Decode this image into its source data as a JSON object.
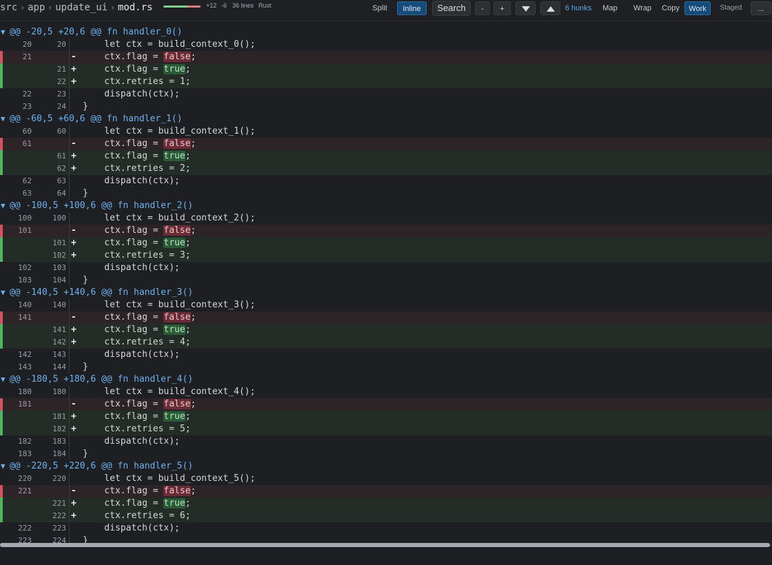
{
  "breadcrumb": {
    "parts": [
      "src",
      "app",
      "update_ui"
    ],
    "current": "mod.rs",
    "separator": "›"
  },
  "file_stats": {
    "additions": "+12",
    "deletions": "-6",
    "lines": "36 lines",
    "language": "Rust",
    "add_fraction": 0.67
  },
  "toolbar": {
    "split": "Split",
    "inline": "Inline",
    "search": "Search",
    "collapse": "-",
    "expand": "+",
    "hunks": "6 hunks",
    "map": "Map",
    "wrap": "Wrap",
    "copy": "Copy",
    "work": "Work",
    "staged": "Staged",
    "more": "...",
    "active_view": "Inline",
    "active_tree": "Work"
  },
  "colors": {
    "accent": "#5fa8e8",
    "added": "#4fb45f",
    "removed": "#d3525f"
  },
  "hunks": [
    {
      "header": "@@ -20,5 +20,6 @@ fn handler_0()",
      "lines": [
        {
          "type": "ctx",
          "old": "20",
          "new": "20",
          "sign": "",
          "code": "    let ctx = build_context_0();"
        },
        {
          "type": "del",
          "old": "21",
          "new": "",
          "sign": "-",
          "pre": "    ctx.flag = ",
          "hl": "false",
          "post": ";"
        },
        {
          "type": "add",
          "old": "",
          "new": "21",
          "sign": "+",
          "pre": "    ctx.flag = ",
          "hl": "true",
          "post": ";"
        },
        {
          "type": "add",
          "old": "",
          "new": "22",
          "sign": "+",
          "code": "    ctx.retries = 1;"
        },
        {
          "type": "ctx",
          "old": "22",
          "new": "23",
          "sign": "",
          "code": "    dispatch(ctx);"
        },
        {
          "type": "ctx",
          "old": "23",
          "new": "24",
          "sign": "",
          "code": "}"
        }
      ]
    },
    {
      "header": "@@ -60,5 +60,6 @@ fn handler_1()",
      "lines": [
        {
          "type": "ctx",
          "old": "60",
          "new": "60",
          "sign": "",
          "code": "    let ctx = build_context_1();"
        },
        {
          "type": "del",
          "old": "61",
          "new": "",
          "sign": "-",
          "pre": "    ctx.flag = ",
          "hl": "false",
          "post": ";"
        },
        {
          "type": "add",
          "old": "",
          "new": "61",
          "sign": "+",
          "pre": "    ctx.flag = ",
          "hl": "true",
          "post": ";"
        },
        {
          "type": "add",
          "old": "",
          "new": "62",
          "sign": "+",
          "code": "    ctx.retries = 2;"
        },
        {
          "type": "ctx",
          "old": "62",
          "new": "63",
          "sign": "",
          "code": "    dispatch(ctx);"
        },
        {
          "type": "ctx",
          "old": "63",
          "new": "64",
          "sign": "",
          "code": "}"
        }
      ]
    },
    {
      "header": "@@ -100,5 +100,6 @@ fn handler_2()",
      "lines": [
        {
          "type": "ctx",
          "old": "100",
          "new": "100",
          "sign": "",
          "code": "    let ctx = build_context_2();"
        },
        {
          "type": "del",
          "old": "101",
          "new": "",
          "sign": "-",
          "pre": "    ctx.flag = ",
          "hl": "false",
          "post": ";"
        },
        {
          "type": "add",
          "old": "",
          "new": "101",
          "sign": "+",
          "pre": "    ctx.flag = ",
          "hl": "true",
          "post": ";"
        },
        {
          "type": "add",
          "old": "",
          "new": "102",
          "sign": "+",
          "code": "    ctx.retries = 3;"
        },
        {
          "type": "ctx",
          "old": "102",
          "new": "103",
          "sign": "",
          "code": "    dispatch(ctx);"
        },
        {
          "type": "ctx",
          "old": "103",
          "new": "104",
          "sign": "",
          "code": "}"
        }
      ]
    },
    {
      "header": "@@ -140,5 +140,6 @@ fn handler_3()",
      "lines": [
        {
          "type": "ctx",
          "old": "140",
          "new": "140",
          "sign": "",
          "code": "    let ctx = build_context_3();"
        },
        {
          "type": "del",
          "old": "141",
          "new": "",
          "sign": "-",
          "pre": "    ctx.flag = ",
          "hl": "false",
          "post": ";"
        },
        {
          "type": "add",
          "old": "",
          "new": "141",
          "sign": "+",
          "pre": "    ctx.flag = ",
          "hl": "true",
          "post": ";"
        },
        {
          "type": "add",
          "old": "",
          "new": "142",
          "sign": "+",
          "code": "    ctx.retries = 4;"
        },
        {
          "type": "ctx",
          "old": "142",
          "new": "143",
          "sign": "",
          "code": "    dispatch(ctx);"
        },
        {
          "type": "ctx",
          "old": "143",
          "new": "144",
          "sign": "",
          "code": "}"
        }
      ]
    },
    {
      "header": "@@ -180,5 +180,6 @@ fn handler_4()",
      "lines": [
        {
          "type": "ctx",
          "old": "180",
          "new": "180",
          "sign": "",
          "code": "    let ctx = build_context_4();"
        },
        {
          "type": "del",
          "old": "181",
          "new": "",
          "sign": "-",
          "pre": "    ctx.flag = ",
          "hl": "false",
          "post": ";"
        },
        {
          "type": "add",
          "old": "",
          "new": "181",
          "sign": "+",
          "pre": "    ctx.flag = ",
          "hl": "true",
          "post": ";"
        },
        {
          "type": "add",
          "old": "",
          "new": "182",
          "sign": "+",
          "code": "    ctx.retries = 5;"
        },
        {
          "type": "ctx",
          "old": "182",
          "new": "183",
          "sign": "",
          "code": "    dispatch(ctx);"
        },
        {
          "type": "ctx",
          "old": "183",
          "new": "184",
          "sign": "",
          "code": "}"
        }
      ]
    },
    {
      "header": "@@ -220,5 +220,6 @@ fn handler_5()",
      "lines": [
        {
          "type": "ctx",
          "old": "220",
          "new": "220",
          "sign": "",
          "code": "    let ctx = build_context_5();"
        },
        {
          "type": "del",
          "old": "221",
          "new": "",
          "sign": "-",
          "pre": "    ctx.flag = ",
          "hl": "false",
          "post": ";"
        },
        {
          "type": "add",
          "old": "",
          "new": "221",
          "sign": "+",
          "pre": "    ctx.flag = ",
          "hl": "true",
          "post": ";"
        },
        {
          "type": "add",
          "old": "",
          "new": "222",
          "sign": "+",
          "code": "    ctx.retries = 6;"
        },
        {
          "type": "ctx",
          "old": "222",
          "new": "223",
          "sign": "",
          "code": "    dispatch(ctx);"
        },
        {
          "type": "ctx",
          "old": "223",
          "new": "224",
          "sign": "",
          "code": "}"
        }
      ]
    }
  ]
}
